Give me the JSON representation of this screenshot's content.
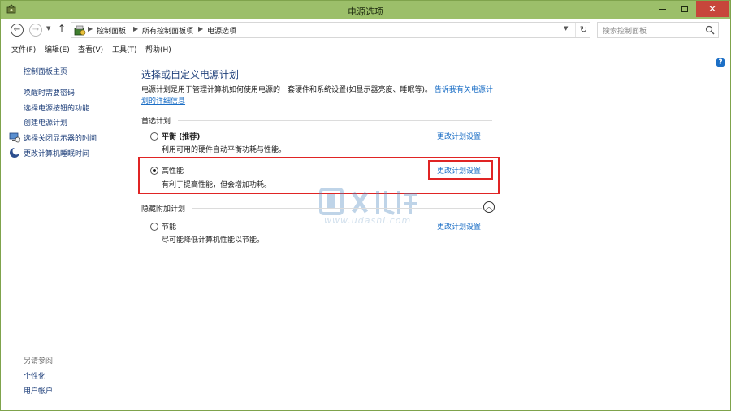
{
  "window": {
    "title": "电源选项",
    "close_glyph": "✕"
  },
  "nav": {
    "breadcrumbs": [
      "控制面板",
      "所有控制面板项",
      "电源选项"
    ],
    "search_placeholder": "搜索控制面板"
  },
  "menu": {
    "items": [
      "文件(F)",
      "编辑(E)",
      "查看(V)",
      "工具(T)",
      "帮助(H)"
    ]
  },
  "sidebar": {
    "home": "控制面板主页",
    "links": [
      "唤醒时需要密码",
      "选择电源按钮的功能",
      "创建电源计划",
      "选择关闭显示器的时间",
      "更改计算机睡眠时间"
    ],
    "see_also_heading": "另请参阅",
    "see_also": [
      "个性化",
      "用户帐户"
    ]
  },
  "main": {
    "title": "选择或自定义电源计划",
    "description": "电源计划是用于管理计算机如何使用电源的一套硬件和系统设置(如显示器亮度、睡眠等)。",
    "description_link": "告诉我有关电源计划的详细信息",
    "preferred_label": "首选计划",
    "hidden_label": "隐藏附加计划",
    "plans": [
      {
        "name": "平衡 (推荐)",
        "desc": "利用可用的硬件自动平衡功耗与性能。",
        "link": "更改计划设置",
        "selected": false
      },
      {
        "name": "高性能",
        "desc": "有利于提高性能，但会增加功耗。",
        "link": "更改计划设置",
        "selected": true
      },
      {
        "name": "节能",
        "desc": "尽可能降低计算机性能以节能。",
        "link": "更改计划设置",
        "selected": false
      }
    ]
  },
  "watermark": {
    "text": "www.udashi.com"
  },
  "colors": {
    "titlebar": "#9cbf6a",
    "link": "#1c6fc6",
    "highlight": "#e02424"
  }
}
